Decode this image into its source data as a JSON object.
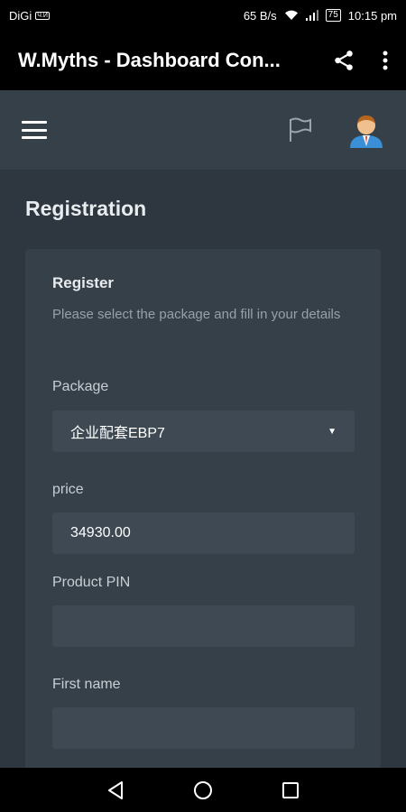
{
  "status_bar": {
    "carrier": "DiGi",
    "carrier_badge": "Ч.И",
    "speed": "65 B/s",
    "battery": "75",
    "time": "10:15 pm"
  },
  "app_bar": {
    "title": "W.Myths - Dashboard Con..."
  },
  "page": {
    "title": "Registration"
  },
  "form": {
    "title": "Register",
    "subtitle": "Please select the package and fill in your details",
    "package_label": "Package",
    "package_value": "企业配套EBP7",
    "price_label": "price",
    "price_value": "34930.00",
    "pin_label": "Product PIN",
    "pin_value": "",
    "first_name_label": "First name",
    "first_name_value": ""
  },
  "icons": {
    "share": "share-icon",
    "more": "more-vert-icon",
    "menu": "hamburger-menu-icon",
    "flag": "flag-icon",
    "avatar": "user-avatar-icon",
    "back": "back-triangle-icon",
    "home": "home-circle-icon",
    "recents": "recents-square-icon"
  }
}
